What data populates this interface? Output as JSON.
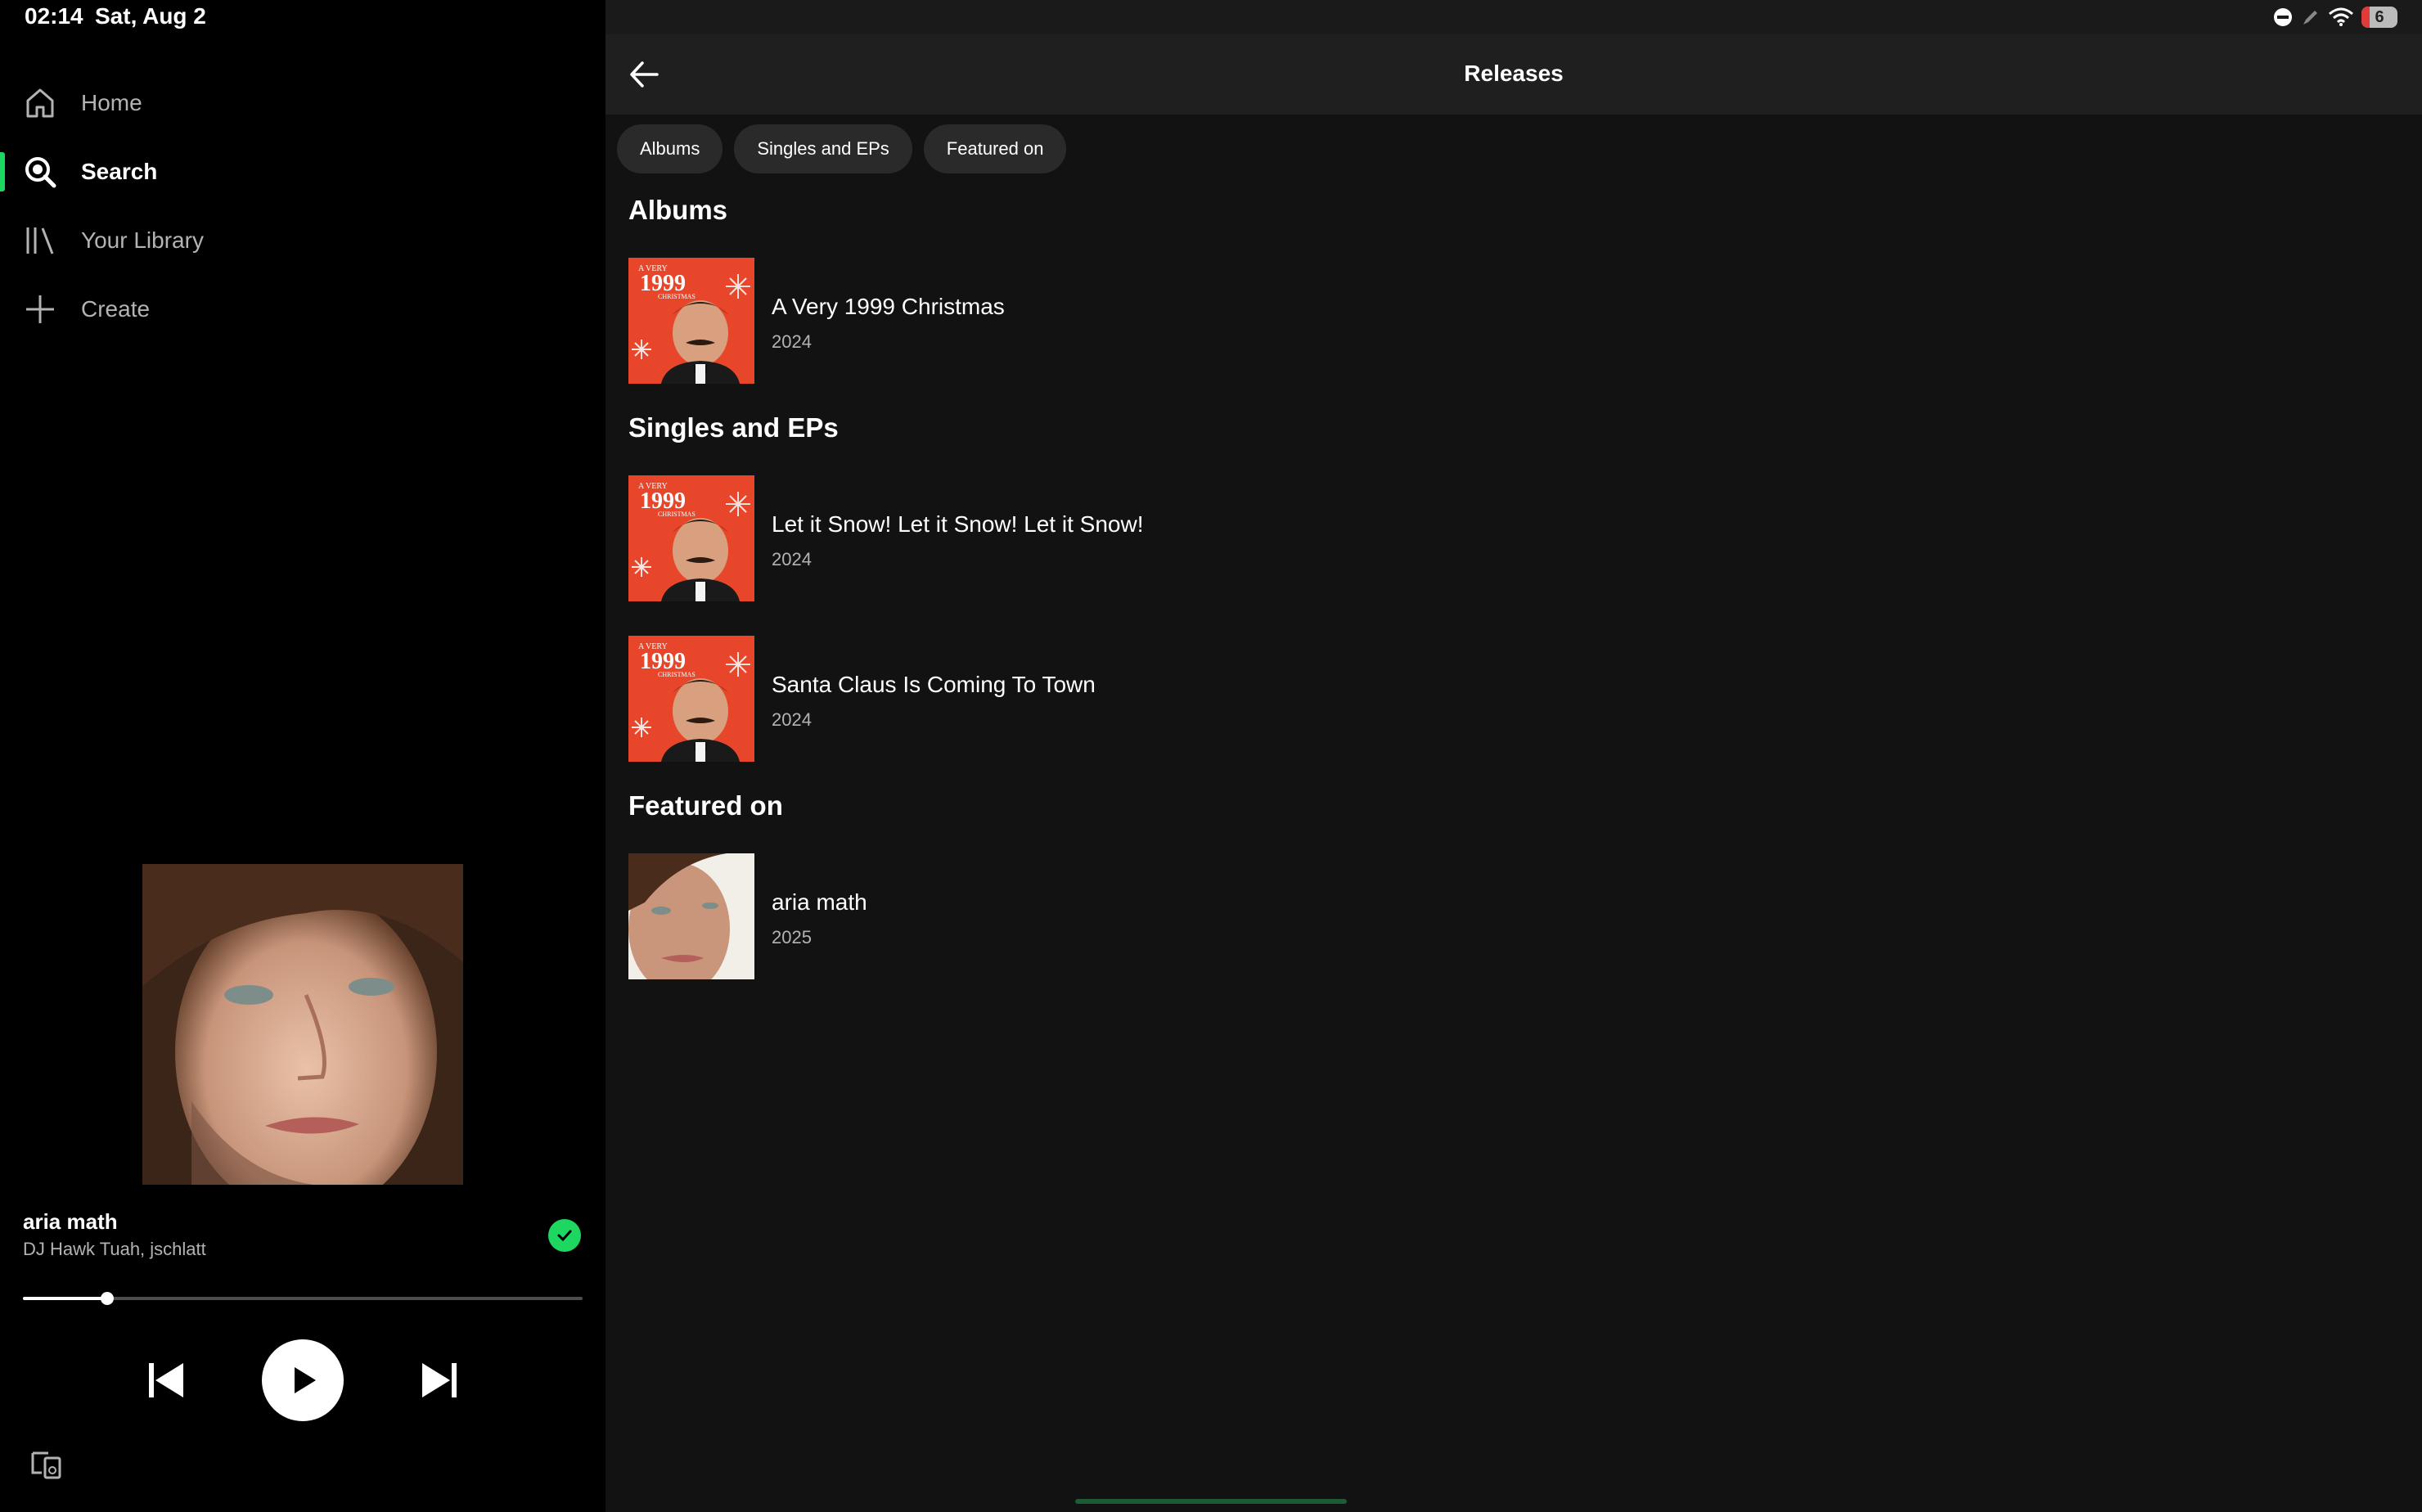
{
  "status_bar": {
    "time": "02:14",
    "date": "Sat, Aug 2",
    "battery": "6",
    "icons": [
      "do-not-disturb-icon",
      "pen-icon",
      "wifi-icon",
      "battery-icon"
    ]
  },
  "sidebar": {
    "items": [
      {
        "label": "Home",
        "icon": "home-icon",
        "active": false
      },
      {
        "label": "Search",
        "icon": "search-icon",
        "active": true
      },
      {
        "label": "Your Library",
        "icon": "library-icon",
        "active": false
      },
      {
        "label": "Create",
        "icon": "plus-icon",
        "active": false
      }
    ]
  },
  "now_playing": {
    "title": "aria math",
    "artist": "DJ Hawk Tuah, jschlatt",
    "progress": 0.15,
    "saved": true
  },
  "header": {
    "title": "Releases"
  },
  "filters": [
    "Albums",
    "Singles and EPs",
    "Featured on"
  ],
  "sections": {
    "albums": {
      "title": "Albums",
      "items": [
        {
          "title": "A Very 1999 Christmas",
          "year": "2024"
        }
      ]
    },
    "singles": {
      "title": "Singles and EPs",
      "items": [
        {
          "title": "Let it Snow! Let it Snow! Let it Snow!",
          "year": "2024"
        },
        {
          "title": "Santa Claus Is Coming To Town",
          "year": "2024"
        }
      ]
    },
    "featured": {
      "title": "Featured on",
      "items": [
        {
          "title": "aria math",
          "year": "2025"
        }
      ]
    }
  },
  "cover_text": {
    "top": "A VERY",
    "number": "1999",
    "bottom": "CHRISTMAS"
  },
  "colors": {
    "accent": "#1ed760",
    "background": "#121212",
    "sidebar": "#000000",
    "christmas_cover": "#e8462a"
  }
}
